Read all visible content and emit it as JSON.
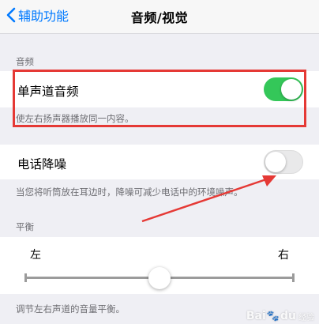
{
  "nav": {
    "back_label": "辅助功能",
    "title": "音频/视觉"
  },
  "audio_section": {
    "header": "音频",
    "mono_audio": {
      "label": "单声道音频",
      "enabled": true,
      "footer": "使左右扬声器播放同一内容。"
    },
    "phone_noise": {
      "label": "电话降噪",
      "enabled": false,
      "footer": "当您将听筒放在耳边时，降噪可减少电话中的环境噪声。"
    }
  },
  "balance_section": {
    "header": "平衡",
    "left_label": "左",
    "right_label": "右",
    "value": 0.5,
    "footer": "调节左右声道的音量平衡。"
  },
  "colors": {
    "accent": "#007aff",
    "switch_on": "#34c759",
    "annotation": "#e53935"
  },
  "watermark": {
    "brand_pre": "Bai",
    "brand_post": "du",
    "sub": "经验"
  }
}
